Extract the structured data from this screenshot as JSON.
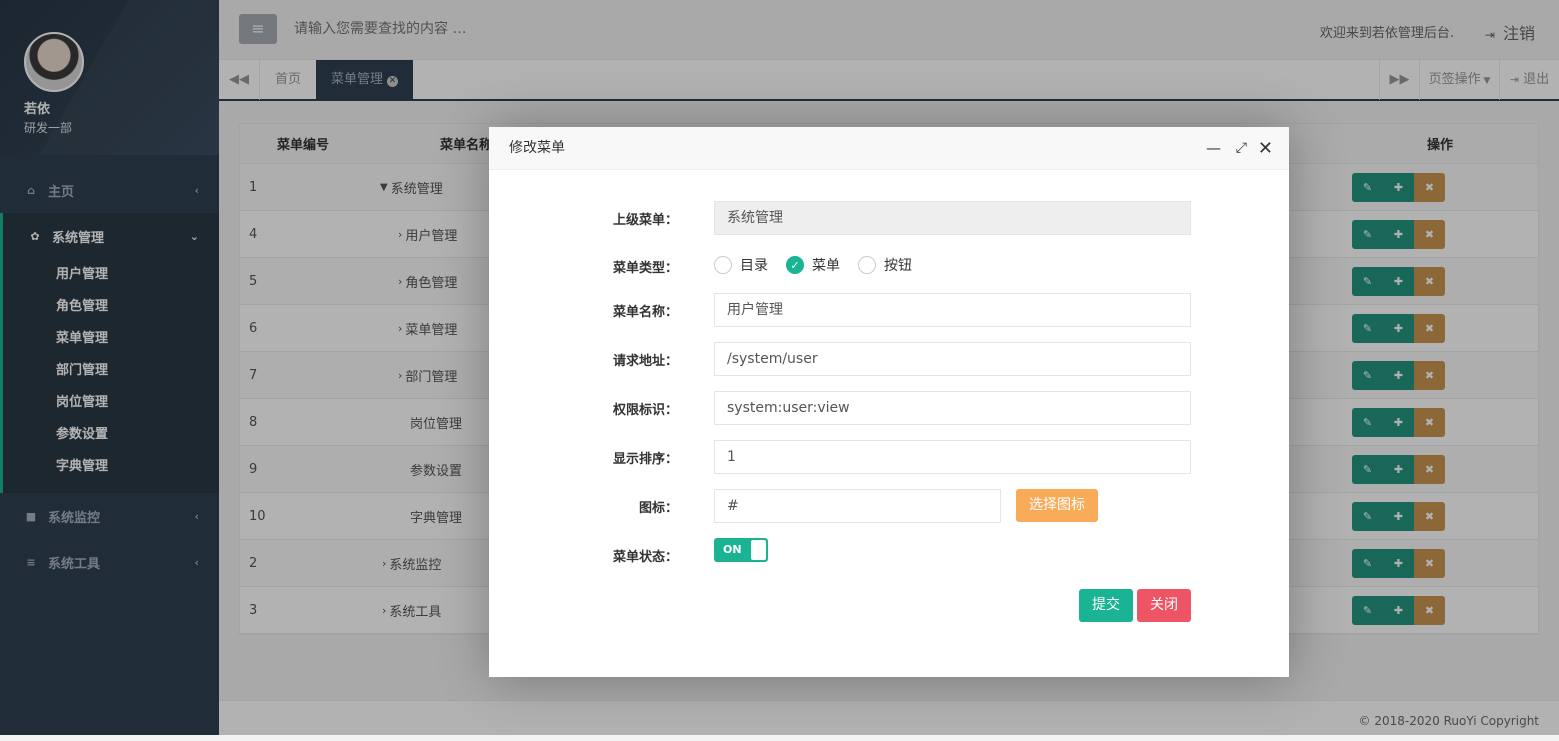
{
  "sidebar": {
    "user_name": "若依",
    "department": "研发一部",
    "items": [
      {
        "label": "主页"
      },
      {
        "label": "系统管理",
        "children": [
          "用户管理",
          "角色管理",
          "菜单管理",
          "部门管理",
          "岗位管理",
          "参数设置",
          "字典管理"
        ]
      },
      {
        "label": "系统监控"
      },
      {
        "label": "系统工具"
      }
    ]
  },
  "topbar": {
    "search_placeholder": "请输入您需要查找的内容 …",
    "welcome": "欢迎来到若依管理后台.",
    "logout": "注销"
  },
  "tabs": {
    "home": "首页",
    "active": "菜单管理",
    "tab_ops": "页签操作",
    "exit": "退出"
  },
  "table": {
    "headers": [
      "菜单编号",
      "菜单名称",
      "操作"
    ],
    "rows": [
      {
        "id": "1",
        "name": "系统管理"
      },
      {
        "id": "4",
        "name": "用户管理"
      },
      {
        "id": "5",
        "name": "角色管理"
      },
      {
        "id": "6",
        "name": "菜单管理"
      },
      {
        "id": "7",
        "name": "部门管理"
      },
      {
        "id": "8",
        "name": "岗位管理"
      },
      {
        "id": "9",
        "name": "参数设置"
      },
      {
        "id": "10",
        "name": "字典管理"
      },
      {
        "id": "2",
        "name": "系统监控"
      },
      {
        "id": "3",
        "name": "系统工具"
      }
    ]
  },
  "modal": {
    "title": "修改菜单",
    "parent_label": "上级菜单：",
    "parent_value": "系统管理",
    "type_label": "菜单类型：",
    "type_options": [
      "目录",
      "菜单",
      "按钮"
    ],
    "name_label": "菜单名称：",
    "name_value": "用户管理",
    "url_label": "请求地址：",
    "url_value": "/system/user",
    "perm_label": "权限标识：",
    "perm_value": "system:user:view",
    "order_label": "显示排序：",
    "order_value": "1",
    "icon_label": "图标：",
    "icon_value": "#",
    "icon_button": "选择图标",
    "status_label": "菜单状态：",
    "status_value": "ON",
    "submit": "提交",
    "close": "关闭"
  },
  "footer": "© 2018-2020 RuoYi Copyright",
  "colors": {
    "sidebar": "#2f4050",
    "accent": "#1ab394",
    "warning": "#f8ac59",
    "danger": "#ed5565"
  }
}
